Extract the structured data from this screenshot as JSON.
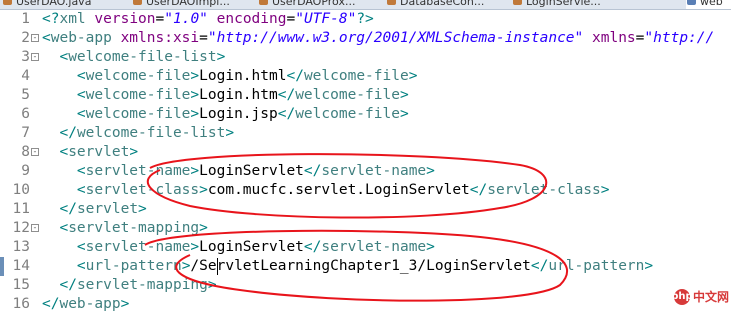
{
  "tabs": [
    {
      "label": "UserDAO.java",
      "icon": "java-file-icon",
      "icon_color": "#c0793a"
    },
    {
      "label": "UserDAOImpl...",
      "icon": "java-file-icon",
      "icon_color": "#c0793a"
    },
    {
      "label": "UserDAOProx...",
      "icon": "java-file-icon",
      "icon_color": "#c0793a"
    },
    {
      "label": "DatabaseCon...",
      "icon": "java-file-icon",
      "icon_color": "#c0793a"
    },
    {
      "label": "LoginServle...",
      "icon": "java-file-icon",
      "icon_color": "#c0793a"
    },
    {
      "label": "web",
      "icon": "xml-file-icon",
      "icon_color": "#5a7fb5"
    }
  ],
  "lines": [
    {
      "n": "1",
      "parts": [
        [
          "b",
          "<?"
        ],
        [
          "t",
          "xml"
        ],
        [
          "x",
          " "
        ],
        [
          "a",
          "version"
        ],
        [
          "x",
          "="
        ],
        [
          "s",
          "\"1.0\""
        ],
        [
          "x",
          " "
        ],
        [
          "a",
          "encoding"
        ],
        [
          "x",
          "="
        ],
        [
          "s",
          "\"UTF-8\""
        ],
        [
          "b",
          "?>"
        ]
      ]
    },
    {
      "n": "2",
      "fold": "-",
      "parts": [
        [
          "b",
          "<"
        ],
        [
          "t",
          "web-app"
        ],
        [
          "x",
          " "
        ],
        [
          "a",
          "xmlns:xsi"
        ],
        [
          "x",
          "="
        ],
        [
          "s",
          "\"http://www.w3.org/2001/XMLSchema-instance\""
        ],
        [
          "x",
          " "
        ],
        [
          "a",
          "xmlns"
        ],
        [
          "x",
          "="
        ],
        [
          "s",
          "\"http://"
        ]
      ]
    },
    {
      "n": "3",
      "fold": "-",
      "parts": [
        [
          "x",
          "  "
        ],
        [
          "b",
          "<"
        ],
        [
          "t",
          "welcome-file-list"
        ],
        [
          "b",
          ">"
        ]
      ]
    },
    {
      "n": "4",
      "parts": [
        [
          "x",
          "    "
        ],
        [
          "b",
          "<"
        ],
        [
          "t",
          "welcome-file"
        ],
        [
          "b",
          ">"
        ],
        [
          "x",
          "Login.html"
        ],
        [
          "b",
          "</"
        ],
        [
          "t",
          "welcome-file"
        ],
        [
          "b",
          ">"
        ]
      ]
    },
    {
      "n": "5",
      "parts": [
        [
          "x",
          "    "
        ],
        [
          "b",
          "<"
        ],
        [
          "t",
          "welcome-file"
        ],
        [
          "b",
          ">"
        ],
        [
          "x",
          "Login.htm"
        ],
        [
          "b",
          "</"
        ],
        [
          "t",
          "welcome-file"
        ],
        [
          "b",
          ">"
        ]
      ]
    },
    {
      "n": "6",
      "parts": [
        [
          "x",
          "    "
        ],
        [
          "b",
          "<"
        ],
        [
          "t",
          "welcome-file"
        ],
        [
          "b",
          ">"
        ],
        [
          "x",
          "Login.jsp"
        ],
        [
          "b",
          "</"
        ],
        [
          "t",
          "welcome-file"
        ],
        [
          "b",
          ">"
        ]
      ]
    },
    {
      "n": "7",
      "parts": [
        [
          "x",
          "  "
        ],
        [
          "b",
          "</"
        ],
        [
          "t",
          "welcome-file-list"
        ],
        [
          "b",
          ">"
        ]
      ]
    },
    {
      "n": "8",
      "fold": "-",
      "parts": [
        [
          "x",
          "  "
        ],
        [
          "b",
          "<"
        ],
        [
          "t",
          "servlet"
        ],
        [
          "b",
          ">"
        ]
      ]
    },
    {
      "n": "9",
      "parts": [
        [
          "x",
          "    "
        ],
        [
          "b",
          "<"
        ],
        [
          "t",
          "servlet-name"
        ],
        [
          "b",
          ">"
        ],
        [
          "x",
          "LoginServlet"
        ],
        [
          "b",
          "</"
        ],
        [
          "t",
          "servlet-name"
        ],
        [
          "b",
          ">"
        ]
      ]
    },
    {
      "n": "10",
      "parts": [
        [
          "x",
          "    "
        ],
        [
          "b",
          "<"
        ],
        [
          "t",
          "servlet-class"
        ],
        [
          "b",
          ">"
        ],
        [
          "x",
          "com.mucfc.servlet.LoginServlet"
        ],
        [
          "b",
          "</"
        ],
        [
          "t",
          "servlet-class"
        ],
        [
          "b",
          ">"
        ]
      ]
    },
    {
      "n": "11",
      "parts": [
        [
          "x",
          "  "
        ],
        [
          "b",
          "</"
        ],
        [
          "t",
          "servlet"
        ],
        [
          "b",
          ">"
        ]
      ]
    },
    {
      "n": "12",
      "fold": "-",
      "parts": [
        [
          "x",
          "  "
        ],
        [
          "b",
          "<"
        ],
        [
          "t",
          "servlet-mapping"
        ],
        [
          "b",
          ">"
        ]
      ]
    },
    {
      "n": "13",
      "parts": [
        [
          "x",
          "    "
        ],
        [
          "b",
          "<"
        ],
        [
          "t",
          "servlet-name"
        ],
        [
          "b",
          ">"
        ],
        [
          "x",
          "LoginServlet"
        ],
        [
          "b",
          "</"
        ],
        [
          "t",
          "servlet-name"
        ],
        [
          "b",
          ">"
        ]
      ]
    },
    {
      "n": "14",
      "marker": true,
      "caret_after_chars": 20,
      "parts": [
        [
          "x",
          "    "
        ],
        [
          "b",
          "<"
        ],
        [
          "t",
          "url-pattern"
        ],
        [
          "b",
          ">"
        ],
        [
          "x",
          "/ServletLearningChapter1_3/LoginServlet"
        ],
        [
          "b",
          "</"
        ],
        [
          "t",
          "url-pattern"
        ],
        [
          "b",
          ">"
        ]
      ]
    },
    {
      "n": "15",
      "parts": [
        [
          "x",
          "  "
        ],
        [
          "b",
          "</"
        ],
        [
          "t",
          "servlet-mapping"
        ],
        [
          "b",
          ">"
        ]
      ]
    },
    {
      "n": "16",
      "parts": [
        [
          "b",
          "</"
        ],
        [
          "t",
          "web-app"
        ],
        [
          "b",
          ">"
        ]
      ]
    }
  ],
  "annotation": {
    "color": "#e8141b"
  },
  "watermark": {
    "logo": "php",
    "text": "中文网"
  }
}
